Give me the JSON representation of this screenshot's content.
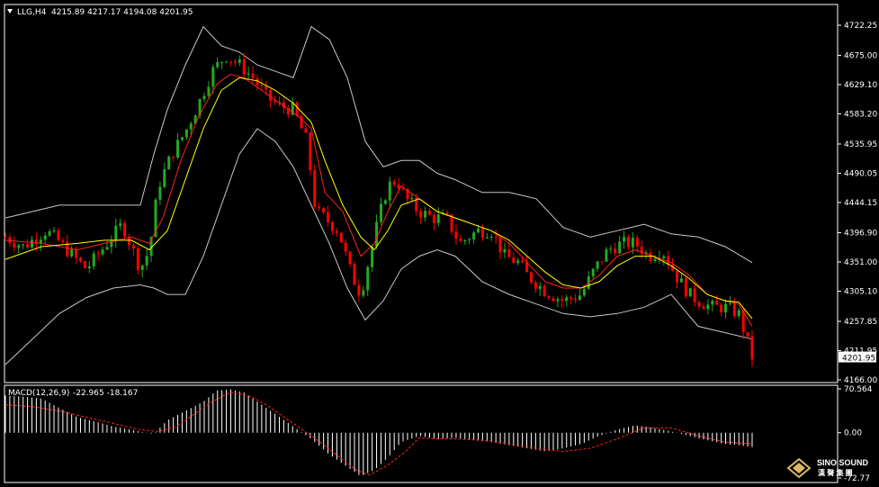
{
  "header": {
    "symbol": "LLG,H4",
    "ohlc": "4215.89 4217.17 4194.08 4201.95"
  },
  "price_axis": {
    "ticks": [
      "4722.25",
      "4675.00",
      "4629.10",
      "4583.20",
      "4535.95",
      "4490.05",
      "4444.15",
      "4396.90",
      "4351.00",
      "4305.10",
      "4257.85",
      "4211.95",
      "4166.00"
    ],
    "current_price": "4201.95"
  },
  "macd_panel": {
    "title": "MACD(12,26,9)",
    "values": "-22.965 -18.167",
    "ticks": [
      "70.564",
      "0.00",
      "-72.77"
    ]
  },
  "watermark": {
    "title": "SINO SOUND",
    "subtitle": "漢 聲 集 團"
  },
  "colors": {
    "background": "#000000",
    "bull_candle": "#22aa22",
    "bear_candle": "#ff0000",
    "bands": "#c8c8c8",
    "fast_ma": "#ff2020",
    "slow_ma": "#ffff00",
    "macd_hist": "#ffffff",
    "macd_signal": "#ff2020",
    "grid_border": "#ffffff"
  },
  "chart_data": [
    {
      "type": "candlestick",
      "title": "LLG,H4",
      "ylim": [
        4166.0,
        4722.25
      ],
      "segments": {
        "x": [
          0,
          20,
          45,
          58,
          75,
          90,
          110,
          130,
          150,
          160,
          170,
          185,
          200,
          215,
          230,
          245,
          260,
          275,
          290,
          305,
          320,
          335,
          345,
          355,
          370,
          385,
          395,
          405,
          415,
          425,
          435,
          445,
          460,
          475,
          490,
          505,
          515,
          525,
          540,
          555,
          570,
          580,
          600,
          620,
          640,
          655,
          670,
          685,
          700,
          715,
          730,
          745,
          760,
          770,
          785,
          800,
          815,
          830
        ],
        "close": [
          4390,
          4375,
          4400,
          4385,
          4360,
          4340,
          4375,
          4410,
          4340,
          4370,
          4470,
          4520,
          4555,
          4600,
          4650,
          4675,
          4660,
          4640,
          4610,
          4595,
          4590,
          4540,
          4430,
          4420,
          4400,
          4330,
          4300,
          4360,
          4420,
          4470,
          4480,
          4450,
          4430,
          4420,
          4420,
          4380,
          4390,
          4400,
          4400,
          4360,
          4350,
          4330,
          4305,
          4290,
          4300,
          4340,
          4370,
          4380,
          4380,
          4360,
          4370,
          4330,
          4300,
          4290,
          4280,
          4280,
          4270,
          4202
        ]
      },
      "bands": {
        "x": [
          0,
          30,
          60,
          90,
          120,
          150,
          165,
          180,
          200,
          220,
          240,
          260,
          280,
          300,
          320,
          340,
          360,
          380,
          400,
          420,
          440,
          460,
          480,
          500,
          530,
          560,
          590,
          620,
          650,
          680,
          710,
          740,
          770,
          800,
          830
        ],
        "upper": [
          4420,
          4430,
          4440,
          4440,
          4440,
          4440,
          4520,
          4590,
          4660,
          4720,
          4690,
          4680,
          4660,
          4650,
          4640,
          4720,
          4700,
          4640,
          4540,
          4500,
          4510,
          4510,
          4490,
          4480,
          4460,
          4460,
          4450,
          4405,
          4390,
          4400,
          4410,
          4395,
          4390,
          4375,
          4350
        ],
        "lower": [
          4190,
          4230,
          4270,
          4295,
          4310,
          4315,
          4310,
          4300,
          4300,
          4360,
          4440,
          4520,
          4560,
          4540,
          4500,
          4440,
          4380,
          4310,
          4260,
          4290,
          4340,
          4360,
          4370,
          4360,
          4320,
          4300,
          4285,
          4270,
          4265,
          4270,
          4280,
          4300,
          4250,
          4240,
          4230
        ]
      },
      "ma_fast": {
        "x": [
          0,
          40,
          80,
          110,
          140,
          160,
          175,
          195,
          215,
          235,
          250,
          265,
          285,
          305,
          325,
          340,
          355,
          375,
          395,
          410,
          425,
          440,
          460,
          480,
          500,
          520,
          540,
          560,
          580,
          600,
          620,
          640,
          660,
          680,
          700,
          720,
          740,
          760,
          780,
          800,
          815,
          830
        ],
        "values": [
          4385,
          4380,
          4370,
          4380,
          4390,
          4380,
          4420,
          4510,
          4580,
          4630,
          4645,
          4640,
          4620,
          4600,
          4580,
          4560,
          4460,
          4430,
          4360,
          4380,
          4430,
          4470,
          4450,
          4430,
          4420,
          4410,
          4400,
          4380,
          4350,
          4320,
          4310,
          4310,
          4330,
          4360,
          4370,
          4360,
          4350,
          4330,
          4300,
          4290,
          4285,
          4250
        ]
      },
      "ma_slow": {
        "x": [
          0,
          40,
          80,
          110,
          140,
          160,
          180,
          200,
          220,
          240,
          260,
          280,
          300,
          320,
          340,
          355,
          375,
          395,
          410,
          425,
          440,
          460,
          480,
          500,
          520,
          540,
          560,
          580,
          600,
          620,
          640,
          660,
          680,
          700,
          720,
          740,
          760,
          780,
          800,
          815,
          830
        ],
        "values": [
          4355,
          4375,
          4380,
          4385,
          4385,
          4370,
          4400,
          4480,
          4560,
          4620,
          4640,
          4635,
          4620,
          4600,
          4570,
          4510,
          4440,
          4390,
          4370,
          4400,
          4440,
          4450,
          4430,
          4420,
          4410,
          4400,
          4385,
          4360,
          4335,
          4315,
          4310,
          4320,
          4345,
          4360,
          4360,
          4345,
          4325,
          4300,
          4290,
          4288,
          4262
        ]
      }
    },
    {
      "type": "bar",
      "title": "MACD(12,26,9)",
      "ylim": [
        -72.77,
        70.564
      ],
      "histogram": {
        "x": [
          0,
          20,
          40,
          60,
          80,
          100,
          120,
          140,
          155,
          165,
          180,
          200,
          220,
          235,
          250,
          265,
          280,
          300,
          320,
          340,
          360,
          380,
          395,
          410,
          425,
          440,
          460,
          480,
          500,
          520,
          540,
          560,
          580,
          600,
          620,
          640,
          660,
          680,
          700,
          720,
          740,
          760,
          780,
          800,
          815,
          830
        ],
        "values": [
          60,
          58,
          55,
          40,
          25,
          18,
          10,
          5,
          0,
          -2,
          20,
          35,
          50,
          68,
          70,
          65,
          50,
          30,
          10,
          -10,
          -35,
          -55,
          -70,
          -60,
          -40,
          -15,
          -5,
          -10,
          -8,
          -12,
          -15,
          -20,
          -25,
          -30,
          -25,
          -18,
          -5,
          5,
          12,
          8,
          2,
          -5,
          -12,
          -18,
          -20,
          -23
        ]
      },
      "signal": {
        "x": [
          0,
          30,
          60,
          90,
          120,
          150,
          170,
          190,
          210,
          230,
          250,
          270,
          290,
          310,
          330,
          350,
          370,
          390,
          405,
          425,
          445,
          460,
          480,
          500,
          530,
          560,
          590,
          620,
          650,
          680,
          710,
          740,
          770,
          800,
          830
        ],
        "values": [
          45,
          42,
          35,
          25,
          15,
          5,
          2,
          10,
          30,
          50,
          65,
          60,
          45,
          25,
          5,
          -15,
          -38,
          -60,
          -68,
          -52,
          -30,
          -8,
          -10,
          -10,
          -12,
          -18,
          -25,
          -30,
          -25,
          -10,
          8,
          8,
          -5,
          -15,
          -18
        ]
      }
    }
  ]
}
